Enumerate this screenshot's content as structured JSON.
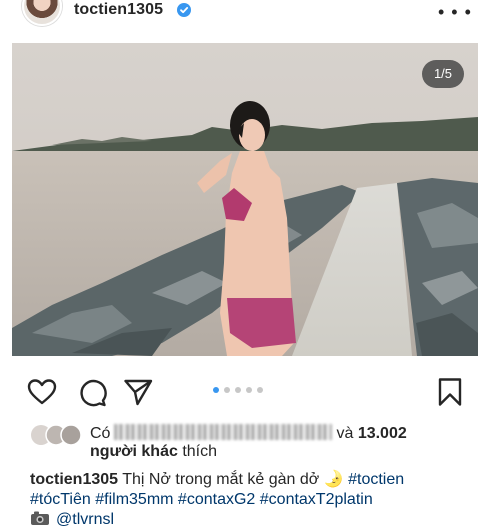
{
  "post": {
    "username": "toctien1305",
    "counter": "1/5",
    "likes": {
      "prefix": "Có",
      "suffix": "và",
      "count": "13.002",
      "line2_bold": "người khác",
      "line2_rest": "thích"
    },
    "caption": {
      "username": "toctien1305",
      "text": "Thị Nở trong mắt kẻ gàn dở 🌛",
      "tags_line1": [
        "#toctien"
      ],
      "tags_line2": [
        "#tócTiên",
        "#film35mm",
        "#contaxG2",
        "#contaxT2platin"
      ],
      "mention": "@tlvrnsl"
    },
    "carousel_dots": 5,
    "active_dot": 0
  },
  "colors": {
    "verified_blue": "#3897f0",
    "hashtag": "#00376b",
    "text": "#262626"
  },
  "icons": [
    "verified-badge-icon",
    "more-options-icon",
    "heart-icon",
    "comment-icon",
    "share-icon",
    "bookmark-icon",
    "camera-icon"
  ]
}
